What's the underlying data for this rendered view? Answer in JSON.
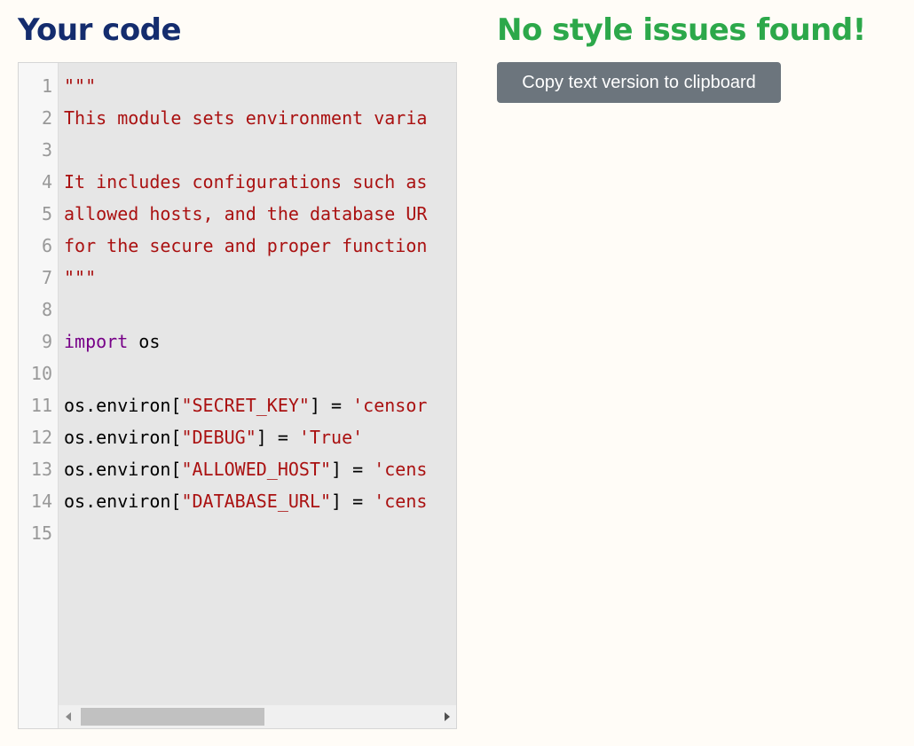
{
  "header": {
    "left_title": "Your code",
    "right_title": "No style issues found!",
    "copy_button_label": "Copy text version to clipboard"
  },
  "colors": {
    "left_title": "#142c6e",
    "right_title": "#2ca84a",
    "button_bg": "#6c757d",
    "string": "#aa1111",
    "keyword": "#770088"
  },
  "editor": {
    "lines": [
      {
        "n": "1",
        "tokens": [
          {
            "t": "\"\"\"",
            "c": "str"
          }
        ]
      },
      {
        "n": "2",
        "tokens": [
          {
            "t": "This module sets environment varia",
            "c": "str"
          }
        ]
      },
      {
        "n": "3",
        "tokens": []
      },
      {
        "n": "4",
        "tokens": [
          {
            "t": "It includes configurations such as",
            "c": "str"
          }
        ]
      },
      {
        "n": "5",
        "tokens": [
          {
            "t": "allowed hosts, and the database UR",
            "c": "str"
          }
        ]
      },
      {
        "n": "6",
        "tokens": [
          {
            "t": "for the secure and proper function",
            "c": "str"
          }
        ]
      },
      {
        "n": "7",
        "tokens": [
          {
            "t": "\"\"\"",
            "c": "str"
          }
        ]
      },
      {
        "n": "8",
        "tokens": []
      },
      {
        "n": "9",
        "tokens": [
          {
            "t": "import",
            "c": "kw"
          },
          {
            "t": " os",
            "c": "plain"
          }
        ]
      },
      {
        "n": "10",
        "tokens": []
      },
      {
        "n": "11",
        "tokens": [
          {
            "t": "os.environ[",
            "c": "plain"
          },
          {
            "t": "\"SECRET_KEY\"",
            "c": "str"
          },
          {
            "t": "] = ",
            "c": "plain"
          },
          {
            "t": "'censor",
            "c": "str"
          }
        ]
      },
      {
        "n": "12",
        "tokens": [
          {
            "t": "os.environ[",
            "c": "plain"
          },
          {
            "t": "\"DEBUG\"",
            "c": "str"
          },
          {
            "t": "] = ",
            "c": "plain"
          },
          {
            "t": "'True'",
            "c": "str"
          }
        ]
      },
      {
        "n": "13",
        "tokens": [
          {
            "t": "os.environ[",
            "c": "plain"
          },
          {
            "t": "\"ALLOWED_HOST\"",
            "c": "str"
          },
          {
            "t": "] = ",
            "c": "plain"
          },
          {
            "t": "'cens",
            "c": "str"
          }
        ]
      },
      {
        "n": "14",
        "tokens": [
          {
            "t": "os.environ[",
            "c": "plain"
          },
          {
            "t": "\"DATABASE_URL\"",
            "c": "str"
          },
          {
            "t": "] = ",
            "c": "plain"
          },
          {
            "t": "'cens",
            "c": "str"
          }
        ]
      },
      {
        "n": "15",
        "tokens": []
      }
    ]
  },
  "icons": {
    "scroll_left": "arrow-left-icon",
    "scroll_right": "arrow-right-icon"
  }
}
